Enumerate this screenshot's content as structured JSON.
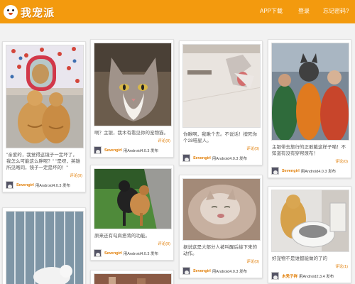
{
  "header": {
    "logo_text": "我宠派",
    "nav": {
      "app_download": "APP下载",
      "login": "登录",
      "forgot_password": "忘记密码?"
    }
  },
  "cards": [
    {
      "desc": "\"亲爱的，我觉得这镜子一定坏了，我怎么可能这么胖呢？\"  \"是呀，英雄所见略同，镜子一定是坏的！\"",
      "comment": "评论(0)",
      "user": "Sevengirl",
      "device": "用Android4.0.3 发布"
    },
    {
      "desc": "啊？主银，我木有看见你的宠物猫。",
      "comment": "评论(0)",
      "user": "Sevengirl",
      "device": "用Android4.0.3 发布"
    },
    {
      "desc": "你瞅啊，我瞅个去。不说话！擅死你个28喵星人。",
      "comment": "评论(0)",
      "user": "Sevengirl",
      "device": "用Android4.0.3 发布"
    },
    {
      "desc": "主银带去旅行的正敢戴这样子喵！不知道有没有穿帮尿布！",
      "comment": "评论(0)",
      "user": "Sevengirl",
      "device": "用Android4.0.3 发布"
    },
    {
      "desc": "原来还有勾肩搭背的功能。",
      "comment": "评论(0)",
      "user": "Sevengirl",
      "device": "用Android4.0.3 发布"
    },
    {
      "desc": "据说这是大部分人被叫醒后接下来的动作。",
      "comment": "评论(0)",
      "user": "Sevengirl",
      "device": "用Android4.0.3 发布"
    },
    {
      "desc": "好宠物不是谁都能做的了的",
      "comment": "评论(1)",
      "user": "木秃子祥",
      "device": "用Android2.3.4 发布"
    }
  ]
}
